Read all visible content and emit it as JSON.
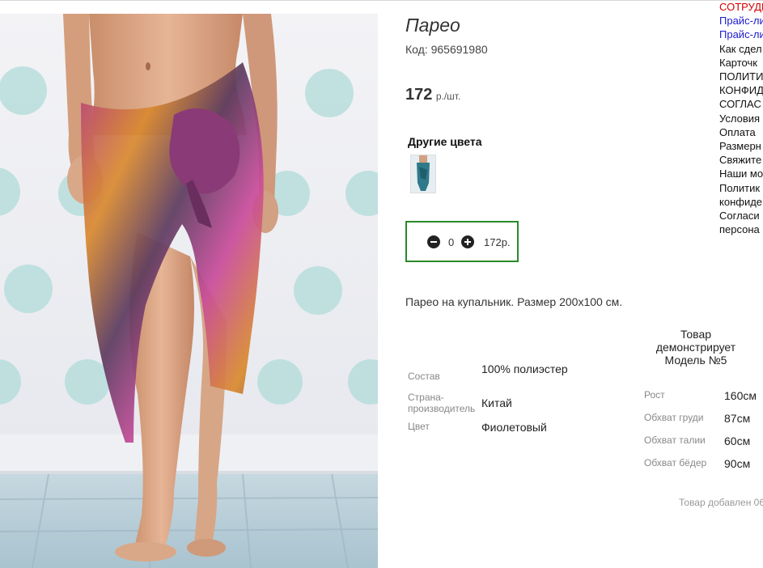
{
  "product": {
    "title": "Парео",
    "code_label": "Код: 965691980",
    "price_value": "172",
    "price_unit": "р./шт.",
    "other_colors_title": "Другие цвета",
    "quantity": "0",
    "sum": "172р.",
    "description": "Парео на купальник. Размер 200х100 см.",
    "attributes": [
      {
        "key": "Состав",
        "value": "100% полиэстер"
      },
      {
        "key": "Страна-производитель",
        "value": "Китай"
      },
      {
        "key": "Цвет",
        "value": "Фиолетовый"
      }
    ],
    "model_title": "Товар демонстрирует Модель №5",
    "measurements": [
      {
        "key": "Рост",
        "value": "160см"
      },
      {
        "key": "Обхват груди",
        "value": "87см"
      },
      {
        "key": "Обхват талии",
        "value": "60см"
      },
      {
        "key": "Обхват бёдер",
        "value": "90см"
      }
    ],
    "added_text": "Товар добавлен 06"
  },
  "side_menu": [
    {
      "label": "СОТРУДН",
      "color": "red"
    },
    {
      "label": "Прайс-ли",
      "color": "blue"
    },
    {
      "label": "Прайс-ли",
      "color": "blue"
    },
    {
      "label": "Как сдел",
      "color": "black"
    },
    {
      "label": "Карточк",
      "color": "black"
    },
    {
      "label": "ПОЛИТИ",
      "color": "black"
    },
    {
      "label": "КОНФИД",
      "color": "black"
    },
    {
      "label": "СОГЛАС",
      "color": "black"
    },
    {
      "label": "Условия",
      "color": "black"
    },
    {
      "label": "Оплата",
      "color": "black"
    },
    {
      "label": "Размерн",
      "color": "black"
    },
    {
      "label": "Свяжите",
      "color": "black"
    },
    {
      "label": "Наши мо",
      "color": "black"
    },
    {
      "label": "Политик",
      "color": "black"
    },
    {
      "label": "конфиде",
      "color": "black"
    },
    {
      "label": "Согласи",
      "color": "black"
    },
    {
      "label": "персона",
      "color": "black"
    }
  ],
  "colors": {
    "accent_green": "#2a8a2a",
    "link_blue": "#1a1acc",
    "link_red": "#d40000"
  }
}
